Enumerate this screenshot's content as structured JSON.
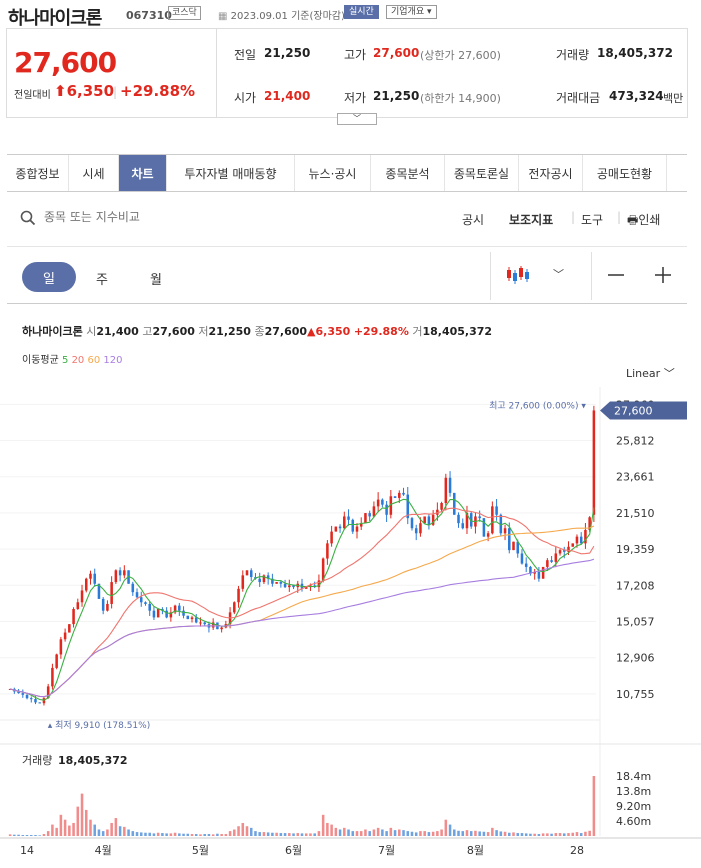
{
  "header": {
    "stock_name": "하나마이크론",
    "stock_code": "067310",
    "market_tag": "코스닥",
    "date_text": "2023.09.01 기준(장마감)",
    "realtime_btn": "실시간",
    "company_btn": "기업개요 ▾"
  },
  "quote": {
    "current_price": "27,600",
    "change_label": "전일대비",
    "change_value": "6,350",
    "change_pct": "+29.88%",
    "prev_close_label": "전일",
    "prev_close": "21,250",
    "high_label": "고가",
    "high": "27,600",
    "upper_limit_text": "(상한가 27,600)",
    "volume_label": "거래량",
    "volume": "18,405,372",
    "open_label": "시가",
    "open": "21,400",
    "low_label": "저가",
    "low": "21,250",
    "lower_limit_text": "(하한가 14,900)",
    "amount_label": "거래대금",
    "amount": "473,324",
    "amount_unit": "백만"
  },
  "tabs": [
    "종합정보",
    "시세",
    "차트",
    "투자자별 매매동향",
    "뉴스·공시",
    "종목분석",
    "종목토론실",
    "전자공시",
    "공매도현황"
  ],
  "active_tab": 2,
  "toolbar": {
    "search_placeholder": "종목 또는 지수비교",
    "disclosure": "공시",
    "indicators": "보조지표",
    "tools": "도구",
    "print": "인쇄"
  },
  "period": {
    "day": "일",
    "week": "주",
    "month": "월"
  },
  "info_line": {
    "name": "하나마이크론",
    "open_label": "시",
    "open": "21,400",
    "high_label": "고",
    "high": "27,600",
    "low_label": "저",
    "low": "21,250",
    "close_label": "종",
    "close": "27,600",
    "change": "▲6,350",
    "change_pct": "+29.88%",
    "volume_label": "거",
    "volume": "18,405,372"
  },
  "ma": {
    "label": "이동평균",
    "periods": [
      "5",
      "20",
      "60",
      "120"
    ],
    "colors": [
      "#3cb043",
      "#f0756e",
      "#f5a94c",
      "#a77ee0"
    ]
  },
  "scale_label": "Linear",
  "colors": {
    "accent": "#5a6fa8",
    "up": "#e0281e",
    "down": "#2a7ad8"
  },
  "chart_data": {
    "type": "candlestick",
    "y_ticks": [
      "27,960",
      "25,812",
      "23,661",
      "21,510",
      "19,359",
      "17,208",
      "15,057",
      "12,906",
      "10,755"
    ],
    "ylim": [
      9500,
      28400
    ],
    "x_labels": [
      "14",
      "4월",
      "5월",
      "6월",
      "7월",
      "8월",
      "28"
    ],
    "max_label": "최고 27,600 (0.00%)",
    "min_label": "최저 9,910 (178.51%)",
    "current_tag": "27,600",
    "volume_label": "거래량",
    "volume_value": "18,405,372",
    "volume_ticks": [
      "18.4m",
      "13.8m",
      "9.20m",
      "4.60m"
    ],
    "volume_max": 18.4,
    "closes": [
      11050,
      10900,
      10800,
      10700,
      10500,
      10450,
      10250,
      10200,
      10500,
      11200,
      12300,
      13100,
      14000,
      14400,
      14900,
      15800,
      16200,
      16900,
      17600,
      17900,
      17300,
      16400,
      15700,
      16100,
      17400,
      18100,
      17800,
      18100,
      17300,
      16800,
      16500,
      16200,
      16100,
      15700,
      15300,
      15800,
      15700,
      15300,
      15600,
      16000,
      15700,
      15400,
      15200,
      15300,
      15000,
      15000,
      14900,
      14700,
      15000,
      14600,
      14700,
      14900,
      15600,
      16200,
      17000,
      17800,
      18100,
      17700,
      17600,
      17400,
      17800,
      17600,
      17300,
      17400,
      17300,
      17100,
      17200,
      17100,
      17300,
      17000,
      17100,
      17200,
      17100,
      17500,
      18800,
      19700,
      20400,
      20700,
      20600,
      21300,
      21100,
      20400,
      20700,
      20900,
      21500,
      21300,
      21900,
      22300,
      22000,
      21400,
      22500,
      22400,
      22700,
      22600,
      21200,
      20600,
      20300,
      20900,
      21300,
      20800,
      21400,
      21700,
      22100,
      23600,
      22700,
      21400,
      20900,
      20600,
      21500,
      20700,
      21300,
      21200,
      20100,
      20300,
      21900,
      21400,
      20300,
      20600,
      19300,
      19800,
      19100,
      18500,
      18300,
      17900,
      18000,
      17600,
      18300,
      18700,
      18600,
      19100,
      19300,
      19200,
      19500,
      19700,
      20100,
      19700,
      20500,
      21250,
      27600
    ],
    "volumes": [
      0.5,
      0.4,
      0.4,
      0.3,
      0.3,
      0.3,
      0.3,
      0.2,
      0.6,
      1.5,
      3.5,
      2.5,
      6.5,
      5,
      3.2,
      4,
      9,
      13,
      8,
      5,
      3.5,
      2,
      1.5,
      2,
      4,
      5.5,
      3,
      2.8,
      2,
      1.5,
      1.2,
      1.1,
      1,
      1,
      0.8,
      1,
      0.9,
      0.8,
      0.8,
      1,
      0.8,
      0.7,
      0.7,
      0.6,
      0.6,
      0.5,
      0.6,
      0.6,
      0.5,
      0.7,
      0.6,
      0.6,
      1.5,
      2,
      3,
      4,
      3,
      2.5,
      1.5,
      1.2,
      1.2,
      1.1,
      1,
      1,
      0.9,
      0.9,
      0.9,
      0.8,
      0.9,
      0.8,
      0.8,
      0.8,
      0.8,
      1.5,
      6.5,
      4,
      3.5,
      2.5,
      2,
      2.5,
      2,
      1.5,
      1.5,
      1.5,
      2,
      1.5,
      2,
      2.5,
      2,
      1.5,
      2.5,
      1.8,
      2,
      1.8,
      1.5,
      1.3,
      1.1,
      1.5,
      1.5,
      1.2,
      1.3,
      1.5,
      2,
      5,
      3.5,
      2,
      1.6,
      1.5,
      1.8,
      1.5,
      1.6,
      1.4,
      1.3,
      1.2,
      2.5,
      1.8,
      1.4,
      1.3,
      1,
      1.1,
      0.9,
      0.9,
      0.8,
      0.7,
      0.7,
      0.6,
      0.8,
      0.8,
      0.7,
      0.9,
      0.9,
      0.8,
      0.9,
      1,
      1.2,
      0.9,
      1.3,
      1.6,
      18.4
    ]
  }
}
